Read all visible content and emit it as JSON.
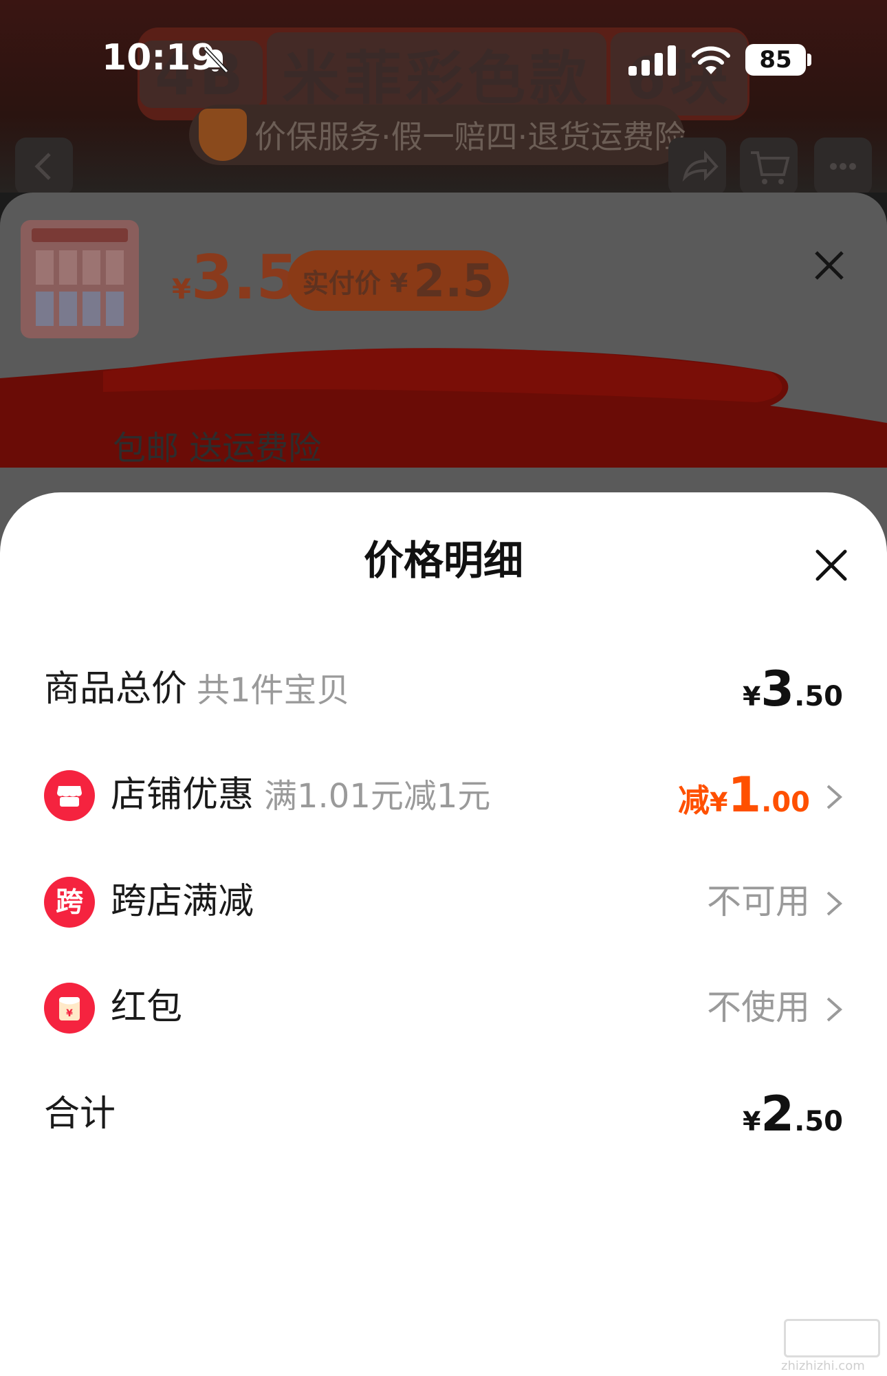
{
  "status_bar": {
    "time": "10:19",
    "battery": "85"
  },
  "background_page": {
    "banner_text": [
      "4B",
      "米菲彩色款",
      "6块"
    ],
    "guarantee_text": "价保服务·假一赔四·退货运费险",
    "price_yen": "¥",
    "price": "3.5",
    "actual_label": "实付价 ¥",
    "actual_price": "2.5",
    "shipping_text": "包邮 送运费险",
    "thumbnail_text": "4B 米菲彩色款 6块"
  },
  "price_detail": {
    "title": "价格明细",
    "rows": {
      "subtotal": {
        "label": "商品总价",
        "sub": "共1件宝贝",
        "yen": "¥",
        "int": "3",
        "dec": ".50"
      },
      "shop_discount": {
        "label": "店铺优惠",
        "sub": "满1.01元减1元",
        "prefix": "减",
        "yen": "¥",
        "int": "1",
        "dec": ".00"
      },
      "cross_store": {
        "label": "跨店满减",
        "status": "不可用"
      },
      "red_packet": {
        "label": "红包",
        "status": "不使用"
      },
      "total": {
        "label": "合计",
        "yen": "¥",
        "int": "2",
        "dec": ".50"
      }
    }
  },
  "watermark": "zhizhizhi.com",
  "colors": {
    "accent_orange": "#ff5000",
    "icon_red": "#f5233f",
    "muted_gray": "#9a9a9a"
  },
  "icons": {
    "shop_discount": "shop-icon",
    "cross_store": "kua-icon",
    "red_packet": "red-packet-icon",
    "close": "close-icon",
    "chevron": "chevron-right-icon"
  }
}
